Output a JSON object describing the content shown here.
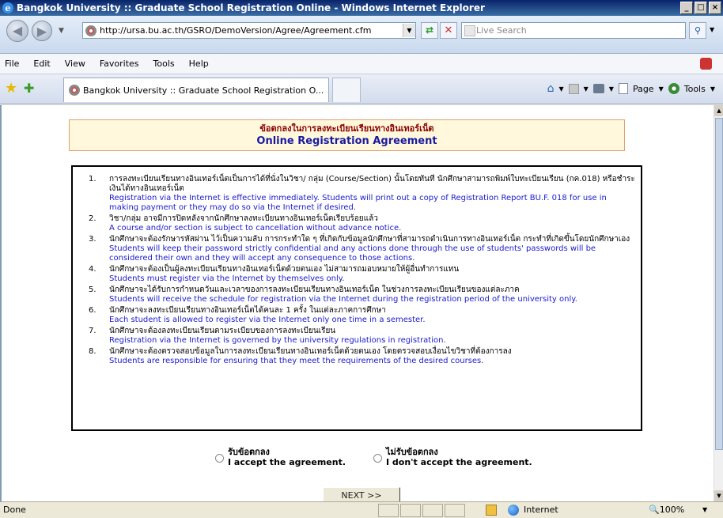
{
  "window": {
    "title": "Bangkok University :: Graduate School Registration Online - Windows Internet Explorer",
    "controls": [
      "_",
      "□",
      "×"
    ]
  },
  "address_bar": {
    "url": "http://ursa.bu.ac.th/GSRO/DemoVersion/Agree/Agreement.cfm",
    "search_placeholder": "Live Search"
  },
  "menu": [
    "File",
    "Edit",
    "View",
    "Favorites",
    "Tools",
    "Help"
  ],
  "tab": {
    "label": "Bangkok University :: Graduate School Registration O..."
  },
  "command_bar": {
    "page_label": "Page",
    "tools_label": "Tools"
  },
  "page": {
    "header_thai": "ข้อตกลงในการลงทะเบียนเรียนทางอินเทอร์เน็ต",
    "header_en": "Online Registration Agreement",
    "terms": [
      {
        "num": "1.",
        "th": "การลงทะเบียนเรียนทางอินเทอร์เน็ตเป็นการได้ที่นั่งในวิชา/ กลุ่ม (Course/Section) นั้นโดยทันที นักศึกษาสามารถพิมพ์ใบทะเบียนเรียน (กค.018) หรือชำระเงินได้ทางอินเทอร์เน็ต",
        "en": "Registration via the Internet is effective immediately. Students will print out a copy of Registration Report BU.F. 018 for use in making payment or they may do so via the Internet if desired."
      },
      {
        "num": "2.",
        "th": "วิชา/กลุ่ม อาจมีการปิดหลังจากนักศึกษาลงทะเบียนทางอินเทอร์เน็ตเรียบร้อยแล้ว",
        "en": "A course and/or section is subject to cancellation without advance notice."
      },
      {
        "num": "3.",
        "th": "นักศึกษาจะต้องรักษารหัสผ่าน ไว้เป็นความลับ การกระทำใด ๆ ที่เกิดกับข้อมูลนักศึกษาที่สามารถดำเนินการทางอินเทอร์เน็ต กระทำที่เกิดขึ้นโดยนักศึกษาเอง",
        "en": "Students will keep their password strictly confidential and any actions done through the use of students' passwords will be considered their own and they will accept any consequence to those actions."
      },
      {
        "num": "4.",
        "th": "นักศึกษาจะต้องเป็นผู้ลงทะเบียนเรียนทางอินเทอร์เน็ตด้วยตนเอง ไม่สามารถมอบหมายให้ผู้อื่นทำการแทน",
        "en": "Students must register via the Internet by themselves only."
      },
      {
        "num": "5.",
        "th": "นักศึกษาจะได้รับการกำหนดวันและเวลาของการลงทะเบียนเรียนทางอินเทอร์เน็ต ในช่วงการลงทะเบียนเรียนของแต่ละภาค",
        "en": "Students will receive the schedule for registration via the Internet during the registration period of the university only."
      },
      {
        "num": "6.",
        "th": "นักศึกษาจะลงทะเบียนเรียนทางอินเทอร์เน็ตได้คนละ 1 ครั้ง ในแต่ละภาคการศึกษา",
        "en": "Each student is allowed to register via the Internet only one time in a semester."
      },
      {
        "num": "7.",
        "th": "นักศึกษาจะต้องลงทะเบียนเรียนตามระเบียบของการลงทะเบียนเรียน",
        "en": "Registration via the Internet is governed by the university regulations in registration."
      },
      {
        "num": "8.",
        "th": "นักศึกษาจะต้องตรวจสอบข้อมูลในการลงทะเบียนเรียนทางอินเทอร์เน็ตด้วยตนเอง โดยตรวจสอบเงื่อนไขวิชาที่ต้องการลง",
        "en": "Students are responsible for ensuring that they meet the requirements of the desired courses."
      }
    ],
    "accept_th": "รับข้อตกลง",
    "accept_en": "I accept the agreement.",
    "decline_th": "ไม่รับข้อตกลง",
    "decline_en": "I don't accept the agreement.",
    "next_label": "NEXT >>"
  },
  "status_bar": {
    "status": "Done",
    "zone": "Internet",
    "zoom": "100%"
  }
}
